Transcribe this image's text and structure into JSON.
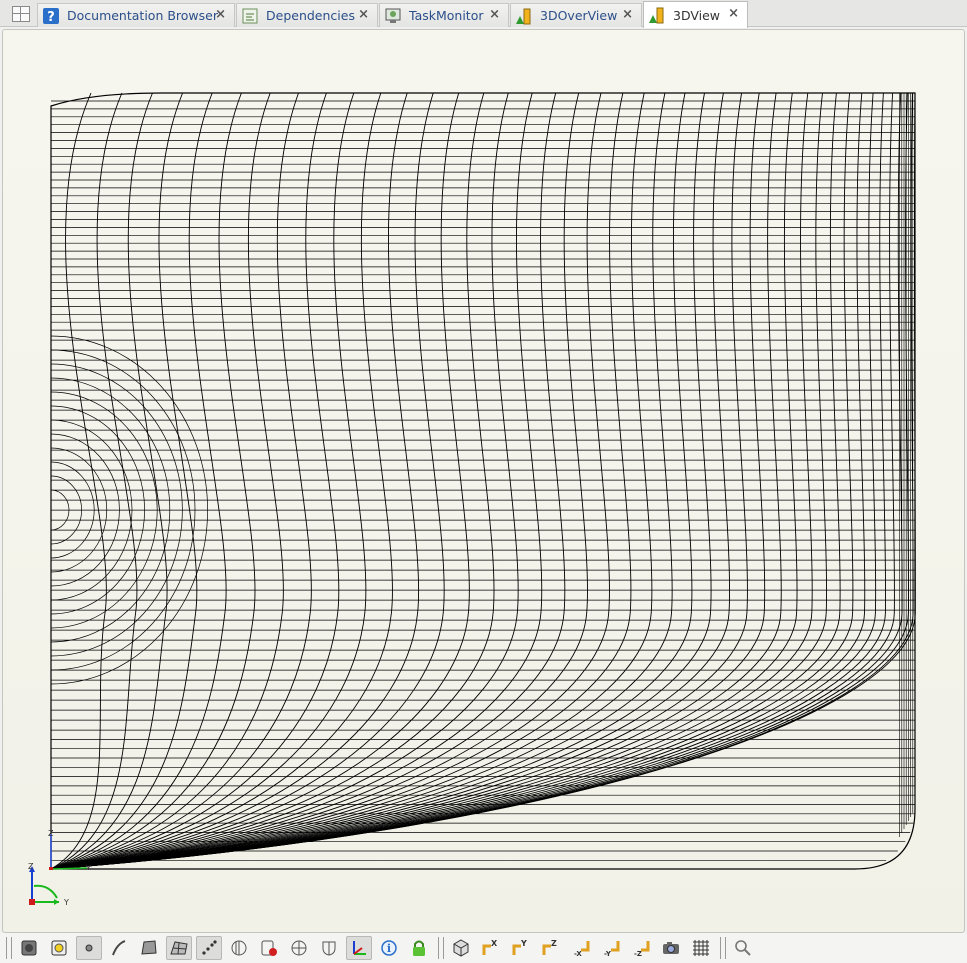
{
  "tabs": [
    {
      "label": "Documentation Browser",
      "icon": "help-icon"
    },
    {
      "label": "Dependencies",
      "icon": "dependencies-icon"
    },
    {
      "label": "TaskMonitor",
      "icon": "task-monitor-icon"
    },
    {
      "label": "3DOverView",
      "icon": "overview-3d-icon"
    },
    {
      "label": "3DView",
      "icon": "view-3d-icon",
      "active": true
    }
  ],
  "close_glyph": "×",
  "triad": {
    "z": "Z",
    "y": "Y"
  },
  "colors": {
    "mesh_line": "#000000",
    "viewport_bg": "#f4f4ec",
    "axis_z": "#1a3fd0",
    "axis_y": "#19b81b",
    "axis_x": "#d01a1a",
    "help_blue": "#2a6fc9",
    "lock_green": "#5bc236"
  },
  "toolbar_icons": [
    "separator",
    "solid-shading-icon",
    "highlight-shading-icon",
    "point-mode-icon",
    "curve-mode-icon",
    "surface-mode-icon",
    "surface-mesh-icon",
    "node-display-icon",
    "volume-display-icon",
    "clip-icon",
    "cut-plane-icon",
    "shrink-icon",
    "axes-icon",
    "info-icon",
    "lock-icon",
    "separator",
    "iso-view-icon",
    "view-x-icon",
    "view-y-icon",
    "view-z-icon",
    "view-minus-x-icon",
    "view-minus-y-icon",
    "view-minus-z-icon",
    "screenshot-icon",
    "grid-icon",
    "separator",
    "zoom-icon"
  ],
  "toolbar_active": [
    "point-mode-icon",
    "surface-mesh-icon",
    "node-display-icon",
    "axes-icon"
  ]
}
